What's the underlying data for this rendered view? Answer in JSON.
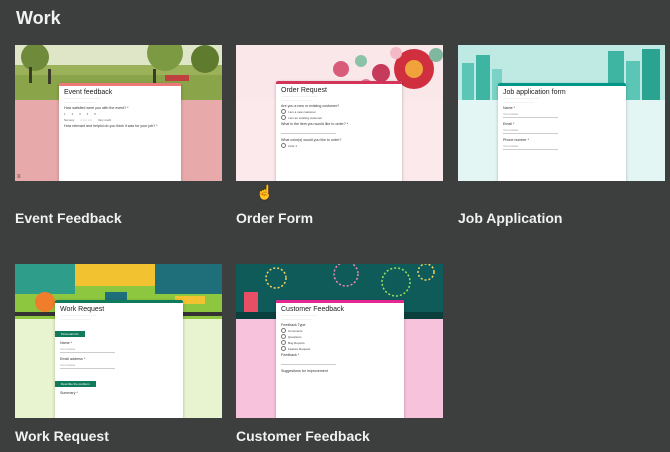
{
  "section": {
    "title": "Work"
  },
  "cards": [
    {
      "label": "Event Feedback",
      "form_title": "Event feedback",
      "q1": "How satisfied were you with the event? *",
      "scale": [
        "1",
        "2",
        "3",
        "4",
        "5"
      ],
      "low": "Not very",
      "high": "Very much",
      "q2": "How relevant and helpful do you think it was for your job? *",
      "colors": {
        "accent": "#e8a9aa",
        "bar": "#ee7878"
      }
    },
    {
      "label": "Order Form",
      "form_title": "Order Request",
      "q1": "Are you a new or existing customer?",
      "options": [
        "I am a new customer",
        "I am an existing customer"
      ],
      "q2": "What is the item you would like to order? *",
      "q3": "What color(s) would you like to order?",
      "option3": "color 1",
      "colors": {
        "accent": "#fbe9eb",
        "bar": "#d4345a"
      }
    },
    {
      "label": "Job Application",
      "form_title": "Job application form",
      "fields": [
        "Name *",
        "Email *",
        "Phone number *"
      ],
      "answer": "Your answer",
      "colors": {
        "accent": "#e3f6f4",
        "bar": "#009688"
      }
    },
    {
      "label": "Work Request",
      "form_title": "Work Request",
      "tag1": "Personal info",
      "fields": [
        "Name *",
        "Email address *"
      ],
      "tag2": "Describe the problem",
      "last": "Summary *",
      "answer": "Your answer",
      "colors": {
        "accent": "#e8f3cf",
        "bar": "#0f7b5a"
      }
    },
    {
      "label": "Customer Feedback",
      "form_title": "Customer Feedback",
      "q1": "Feedback Type",
      "options": [
        "Comments",
        "Questions",
        "Bug Reports",
        "Feature Request"
      ],
      "q2": "Feedback *",
      "q3": "Suggestions for improvement",
      "colors": {
        "accent": "#f7c3dc",
        "bar": "#e52592"
      }
    }
  ],
  "cursor_icon": "hand-pointer-icon"
}
